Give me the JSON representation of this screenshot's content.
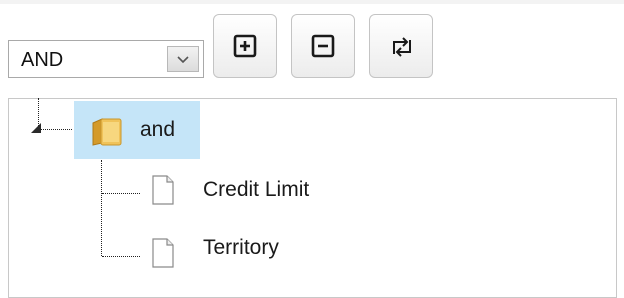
{
  "filter": {
    "operator_select": {
      "selected": "AND"
    },
    "toolbar": {
      "add_icon": "plus-square-icon",
      "remove_icon": "minus-square-icon",
      "reset_icon": "refresh-arrows-icon"
    },
    "tree": {
      "root": {
        "label": "and",
        "icon": "folder-icon",
        "expanded": true,
        "selected": true
      },
      "children": [
        {
          "label": "Credit Limit",
          "icon": "document-icon"
        },
        {
          "label": "Territory",
          "icon": "document-icon"
        }
      ]
    }
  },
  "colors": {
    "selection_background": "#c5e5f8",
    "folder": "#e8b544",
    "border": "#c8c8c8"
  }
}
